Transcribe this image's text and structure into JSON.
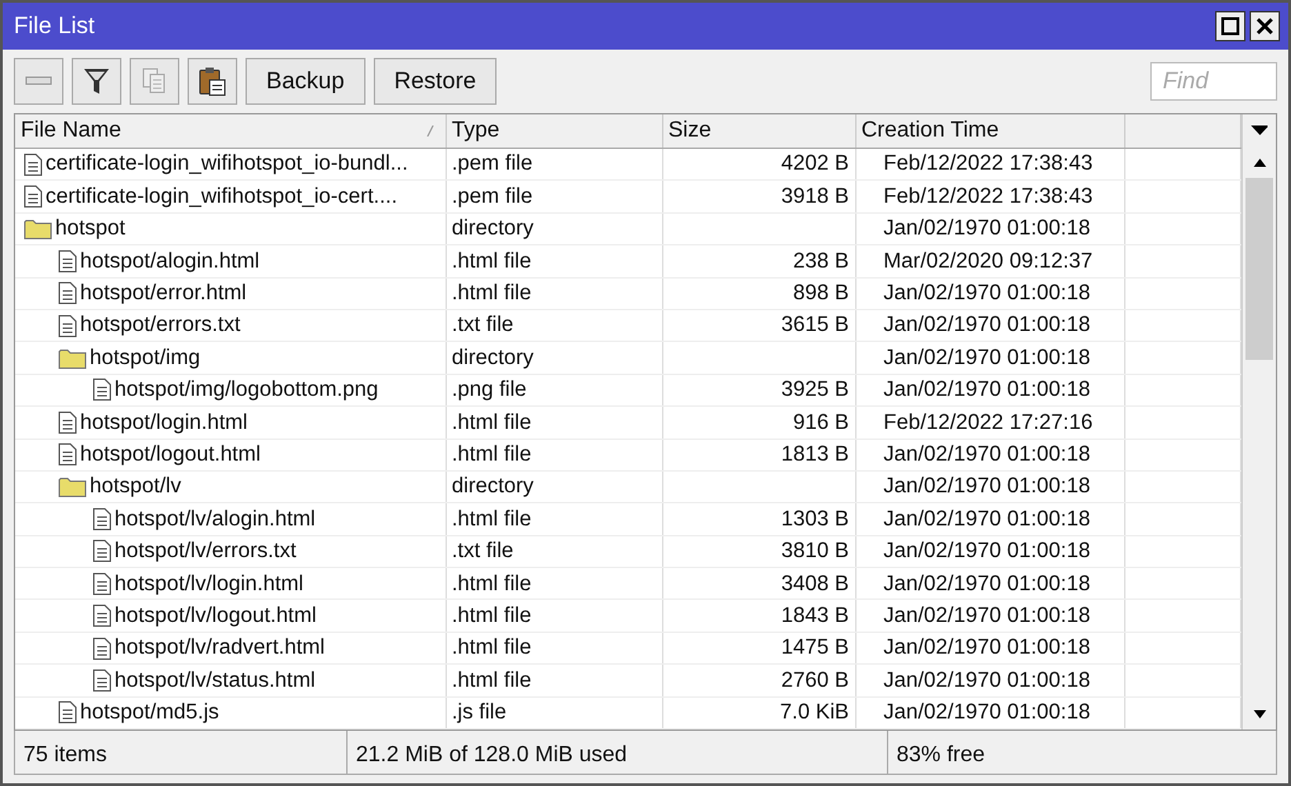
{
  "window": {
    "title": "File List"
  },
  "toolbar": {
    "buttons": [
      "Backup",
      "Restore"
    ],
    "search": {
      "placeholder": "Find"
    }
  },
  "table": {
    "columns": [
      "File Name",
      "Type",
      "Size",
      "Creation Time"
    ],
    "rows": [
      {
        "kind": "file",
        "name": "certificate-login_wifihotspot_io-bundl...",
        "type": ".pem file",
        "size": "4202 B",
        "created": "Feb/12/2022 17:38:43"
      },
      {
        "kind": "file",
        "name": "certificate-login_wifihotspot_io-cert....",
        "type": ".pem file",
        "size": "3918 B",
        "created": "Feb/12/2022 17:38:43"
      },
      {
        "kind": "folder",
        "name": "hotspot",
        "type": "directory",
        "created": "Jan/02/1970 01:00:18",
        "children": [
          {
            "kind": "file",
            "name": "hotspot/alogin.html",
            "type": ".html file",
            "size": "238 B",
            "created": "Mar/02/2020 09:12:37"
          },
          {
            "kind": "file",
            "name": "hotspot/error.html",
            "type": ".html file",
            "size": "898 B",
            "created": "Jan/02/1970 01:00:18"
          },
          {
            "kind": "file",
            "name": "hotspot/errors.txt",
            "type": ".txt file",
            "size": "3615 B",
            "created": "Jan/02/1970 01:00:18"
          },
          {
            "kind": "folder",
            "name": "hotspot/img",
            "type": "directory",
            "created": "Jan/02/1970 01:00:18",
            "children": [
              {
                "kind": "file",
                "name": "hotspot/img/logobottom.png",
                "type": ".png file",
                "size": "3925 B",
                "created": "Jan/02/1970 01:00:18"
              }
            ]
          },
          {
            "kind": "file",
            "name": "hotspot/login.html",
            "type": ".html file",
            "size": "916 B",
            "created": "Feb/12/2022 17:27:16"
          },
          {
            "kind": "file",
            "name": "hotspot/logout.html",
            "type": ".html file",
            "size": "1813 B",
            "created": "Jan/02/1970 01:00:18"
          },
          {
            "kind": "folder",
            "name": "hotspot/lv",
            "type": "directory",
            "created": "Jan/02/1970 01:00:18",
            "children": [
              {
                "kind": "file",
                "name": "hotspot/lv/alogin.html",
                "type": ".html file",
                "size": "1303 B",
                "created": "Jan/02/1970 01:00:18"
              },
              {
                "kind": "file",
                "name": "hotspot/lv/errors.txt",
                "type": ".txt file",
                "size": "3810 B",
                "created": "Jan/02/1970 01:00:18"
              },
              {
                "kind": "file",
                "name": "hotspot/lv/login.html",
                "type": ".html file",
                "size": "3408 B",
                "created": "Jan/02/1970 01:00:18"
              },
              {
                "kind": "file",
                "name": "hotspot/lv/logout.html",
                "type": ".html file",
                "size": "1843 B",
                "created": "Jan/02/1970 01:00:18"
              },
              {
                "kind": "file",
                "name": "hotspot/lv/radvert.html",
                "type": ".html file",
                "size": "1475 B",
                "created": "Jan/02/1970 01:00:18"
              },
              {
                "kind": "file",
                "name": "hotspot/lv/status.html",
                "type": ".html file",
                "size": "2760 B",
                "created": "Jan/02/1970 01:00:18"
              }
            ]
          },
          {
            "kind": "file",
            "name": "hotspot/md5.js",
            "type": ".js file",
            "size": "7.0 KiB",
            "created": "Jan/02/1970 01:00:18"
          }
        ]
      }
    ]
  },
  "status_bar": [
    "75 items",
    "21.2 MiB of 128.0 MiB used",
    "83% free"
  ]
}
